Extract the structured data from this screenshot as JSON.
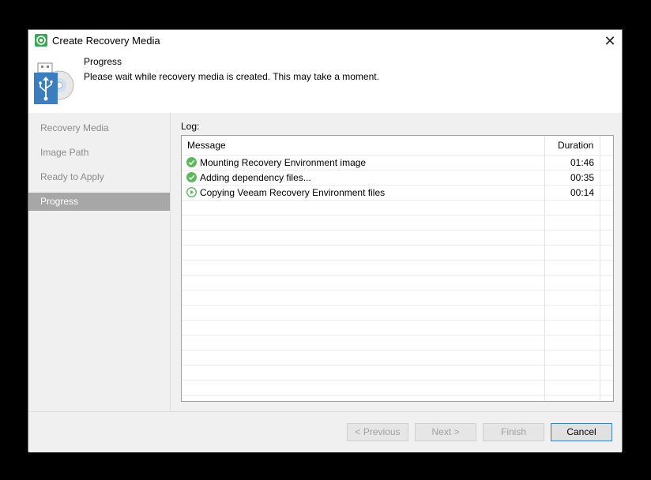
{
  "window": {
    "title": "Create Recovery Media",
    "app_icon": "veeam-app-icon",
    "close_icon": "close-icon",
    "close_glyph": "✕"
  },
  "header": {
    "title": "Progress",
    "description": "Please wait while recovery media is created. This may take a moment.",
    "icon": "usb-disc-icon"
  },
  "sidebar": {
    "items": [
      {
        "label": "Recovery Media",
        "active": false
      },
      {
        "label": "Image Path",
        "active": false
      },
      {
        "label": "Ready to Apply",
        "active": false
      },
      {
        "label": "Progress",
        "active": true
      }
    ]
  },
  "log": {
    "label": "Log:",
    "columns": {
      "message": "Message",
      "duration": "Duration"
    },
    "rows": [
      {
        "status": "completed",
        "icon": "check-circle-icon",
        "message": "Mounting Recovery Environment image",
        "duration": "01:46"
      },
      {
        "status": "completed",
        "icon": "check-circle-icon",
        "message": "Adding dependency files...",
        "duration": "00:35"
      },
      {
        "status": "in-progress",
        "icon": "play-circle-icon",
        "message": "Copying Veeam Recovery Environment files",
        "duration": "00:14"
      }
    ]
  },
  "footer": {
    "previous": "< Previous",
    "next": "Next >",
    "finish": "Finish",
    "cancel": "Cancel"
  },
  "colors": {
    "accent": "#3a7bd5",
    "success": "#5cb85c",
    "sidebar_active": "#a7a7a7"
  }
}
